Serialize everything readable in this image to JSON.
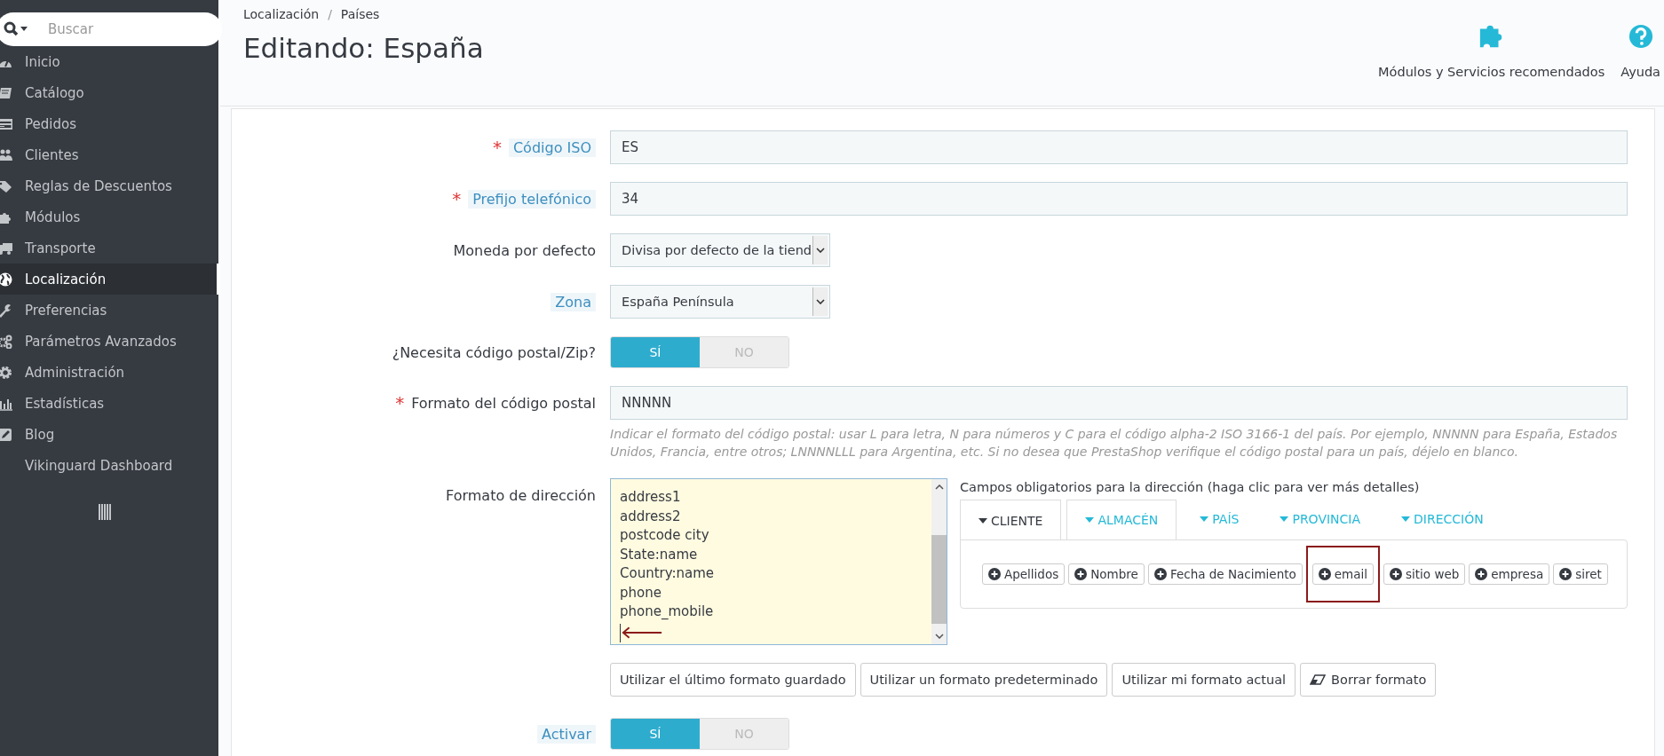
{
  "sidebar": {
    "search": {
      "placeholder": "Buscar"
    },
    "items": [
      {
        "label": "Inicio",
        "selected": false
      },
      {
        "label": "Catálogo",
        "selected": false
      },
      {
        "label": "Pedidos",
        "selected": false
      },
      {
        "label": "Clientes",
        "selected": false
      },
      {
        "label": "Reglas de Descuentos",
        "selected": false
      },
      {
        "label": "Módulos",
        "selected": false
      },
      {
        "label": "Transporte",
        "selected": false
      },
      {
        "label": "Localización",
        "selected": true
      },
      {
        "label": "Preferencias",
        "selected": false
      },
      {
        "label": "Parámetros Avanzados",
        "selected": false
      },
      {
        "label": "Administración",
        "selected": false
      },
      {
        "label": "Estadísticas",
        "selected": false
      },
      {
        "label": "Blog",
        "selected": false
      },
      {
        "label": "Vikinguard Dashboard",
        "selected": false
      }
    ]
  },
  "breadcrumb": [
    "Localización",
    "/",
    "Países"
  ],
  "title": "Editando: España",
  "toolbar": [
    {
      "label": "Módulos y Servicios recomendados"
    },
    {
      "label": "Ayuda"
    }
  ],
  "fields": [
    {
      "kind": "text",
      "label": "Código ISO",
      "required_mark": "*",
      "hint": true,
      "value": "ES"
    },
    {
      "kind": "text",
      "label": "Prefijo telefónico",
      "required_mark": "*",
      "hint": true,
      "value": "34"
    },
    {
      "kind": "select",
      "label": "Moneda por defecto",
      "hint": false,
      "value": "Divisa por defecto de la tiend"
    },
    {
      "kind": "select",
      "label": "Zona",
      "hint": true,
      "value": "España Península"
    },
    {
      "kind": "toggle",
      "label": "¿Necesita código postal/Zip?",
      "hint": false,
      "on": true,
      "yes": "SÍ",
      "no": "NO"
    },
    {
      "kind": "text",
      "label": "Formato del código postal",
      "required_mark": "*",
      "hint": false,
      "value": "NNNNN",
      "help": "Indicar el formato del código postal: usar L para letra, N para números y C para el código alpha-2 ISO 3166-1 del país. Por ejemplo, NNNNN para España, Estados Unidos, Francia, entre otros; LNNNNLLL para Argentina, etc. Si no desea que PrestaShop verifique el código postal para un país, déjelo en blanco."
    }
  ],
  "address": {
    "label": "Formato de dirección",
    "lines": [
      "address1",
      "address2",
      "postcode city",
      "State:name",
      "Country:name",
      "phone",
      "phone_mobile"
    ],
    "fields_title": "Campos obligatorios para la dirección (haga clic para ver más detalles)",
    "tabs": [
      {
        "label": "CLIENTE",
        "selected": true
      },
      {
        "label": "ALMACÉN",
        "selected": false
      },
      {
        "label": "PAÍS",
        "selected": false
      },
      {
        "label": "PROVINCIA",
        "selected": false
      },
      {
        "label": "DIRECCIÓN",
        "selected": false
      }
    ],
    "chips": [
      {
        "label": "Apellidos",
        "highlighted": false
      },
      {
        "label": "Nombre",
        "highlighted": false
      },
      {
        "label": "Fecha de Nacimiento",
        "highlighted": false
      },
      {
        "label": "email",
        "highlighted": true
      },
      {
        "label": "sitio web",
        "highlighted": false
      },
      {
        "label": "empresa",
        "highlighted": false
      },
      {
        "label": "siret",
        "highlighted": false
      }
    ],
    "buttons": [
      {
        "label": "Utilizar el último formato guardado"
      },
      {
        "label": "Utilizar un formato predeterminado"
      },
      {
        "label": "Utilizar mi formato actual"
      },
      {
        "label": "Borrar formato"
      }
    ]
  },
  "active": {
    "label": "Activar",
    "hint": true,
    "on": true,
    "yes": "SÍ",
    "no": "NO"
  }
}
